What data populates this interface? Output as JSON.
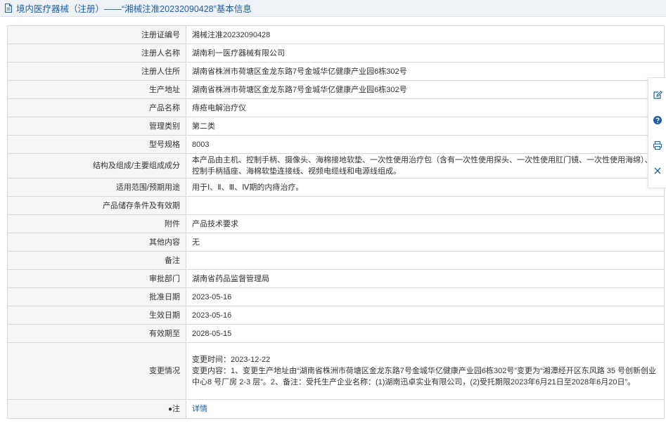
{
  "header": {
    "title": "境内医疗器械（注册）——“湘械注准20232090428”基本信息"
  },
  "rows": [
    {
      "label": "注册证编号",
      "value": "湘械注准20232090428"
    },
    {
      "label": "注册人名称",
      "value": "湖南利一医疗器械有限公司"
    },
    {
      "label": "注册人住所",
      "value": "湖南省株洲市荷塘区金龙东路7号金城华亿健康产业园6栋302号"
    },
    {
      "label": "生产地址",
      "value": "湖南省株洲市荷塘区金龙东路7号金城华亿健康产业园6栋302号"
    },
    {
      "label": "产品名称",
      "value": "痔疮电解治疗仪"
    },
    {
      "label": "管理类别",
      "value": "第二类"
    },
    {
      "label": "型号规格",
      "value": "8003"
    },
    {
      "label": "结构及组成/主要组成成分",
      "value": "本产品由主机、控制手柄、摄像头、海棉接地软垫、一次性使用治疗包（含有一次性使用探头、一次性使用肛门镜、一次性使用海绵）、控制手柄插座、海棉软垫连接线、视频电缆线和电源线组成。"
    },
    {
      "label": "适用范围/预期用途",
      "value": "用于Ⅰ、Ⅱ、Ⅲ、Ⅳ期的内痔治疗。"
    },
    {
      "label": "产品储存条件及有效期",
      "value": ""
    },
    {
      "label": "附件",
      "value": "产品技术要求"
    },
    {
      "label": "其他内容",
      "value": "无"
    },
    {
      "label": "备注",
      "value": ""
    },
    {
      "label": "审批部门",
      "value": "湖南省药品监督管理局"
    },
    {
      "label": "批准日期",
      "value": "2023-05-16"
    },
    {
      "label": "生效日期",
      "value": "2023-05-16"
    },
    {
      "label": "有效期至",
      "value": "2028-05-15"
    },
    {
      "label": "变更情况",
      "value_lines": [
        "变更时间：2023-12-22",
        "变更内容：1、变更生产地址由“湖南省株洲市荷塘区金龙东路7号金城华亿健康产业园6栋302号”变更为“湘潭经开区东风路 35 号创新创业中心8 号厂房 2-3 层”。2、备注：受托生产企业名称：(1)湖南迅卓实业有限公司，(2)受托期限2023年6月21日至2028年6月20日”。"
      ]
    },
    {
      "label": "注",
      "value": "详情"
    }
  ],
  "icons": {
    "title": "document-icon",
    "note_label": "pin-icon",
    "sidebar": [
      "edit-icon",
      "help-icon",
      "print-icon",
      "close-icon"
    ]
  },
  "colors": {
    "title_text": "#1f5fa8",
    "link": "#1f5fa8",
    "label_bg": "#f5f5f5",
    "border": "#d8d8d8"
  }
}
